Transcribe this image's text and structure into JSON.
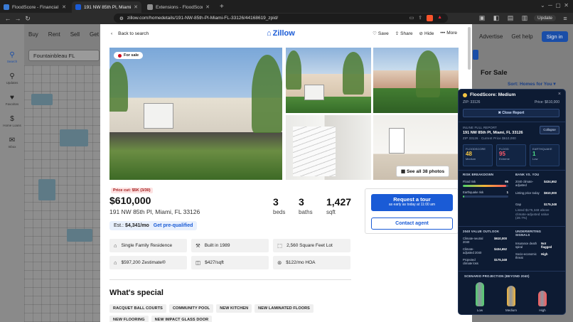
{
  "browser": {
    "tabs": [
      {
        "title": "FloodScore - Financial Transparency",
        "active": false,
        "color": "#3a7bd5"
      },
      {
        "title": "191 NW 85th Pl, Miami, FL 3...",
        "active": true,
        "color": "#1a5bd6"
      },
      {
        "title": "Extensions - FloodScore",
        "active": false,
        "color": "#8e8e8e"
      }
    ],
    "url": "zillow.com/homedetails/191-NW-85th-Pl-Miami-FL-33126/44168619_zpid/",
    "update_label": "Update"
  },
  "background": {
    "nav": [
      "Buy",
      "Rent",
      "Sell",
      "Get a m..."
    ],
    "right_nav": [
      "Advertise",
      "Get help"
    ],
    "sign_in": "Sign in",
    "search_value": "Fountainbleau FL",
    "rail": [
      {
        "label": "Search",
        "icon": "search-icon"
      },
      {
        "label": "Updates",
        "icon": "updates-icon"
      },
      {
        "label": "Favorites",
        "icon": "heart-icon"
      },
      {
        "label": "Home Loans",
        "icon": "dollar-icon"
      },
      {
        "label": "Inbox",
        "icon": "inbox-icon"
      }
    ],
    "for_sale_heading": "For Sale",
    "sort_label": "Sort: Homes for You ▾"
  },
  "listing": {
    "back_label": "Back to search",
    "logo_text": "Zillow",
    "actions": [
      "Save",
      "Share",
      "Hide",
      "More"
    ],
    "badge": "For sale",
    "see_all": "See all 38 photos",
    "price_cut": "Price cut: $5K (3/30)",
    "price": "$610,000",
    "address": "191 NW 85th Pl, Miami, FL 33126",
    "beds": {
      "value": "3",
      "label": "beds"
    },
    "baths": {
      "value": "3",
      "label": "baths"
    },
    "sqft": {
      "value": "1,427",
      "label": "sqft"
    },
    "est_label": "Est.:",
    "est_value": "$4,341/mo",
    "prequal": "Get pre-qualified",
    "request_tour": "Request a tour",
    "request_sub": "as early as today at 11:00 am",
    "contact_agent": "Contact agent",
    "facts": [
      {
        "icon": "house-icon",
        "text": "Single Family Residence"
      },
      {
        "icon": "hammer-icon",
        "text": "Built in 1989"
      },
      {
        "icon": "lot-icon",
        "text": "2,560 Square Feet Lot"
      },
      {
        "icon": "zestimate-icon",
        "text": "$597,200 Zestimate®"
      },
      {
        "icon": "ruler-icon",
        "text": "$427/sqft"
      },
      {
        "icon": "hoa-icon",
        "text": "$122/mo HOA"
      }
    ],
    "whats_special": "What's special",
    "tags": [
      "RACQUET BALL COURTS",
      "COMMUNITY POOL",
      "NEW KITCHEN",
      "NEW LAMINATED FLOORS",
      "NEW FLOORING",
      "NEW IMPACT GLASS DOOR"
    ]
  },
  "floodscore": {
    "title": "FloodScore: Medium",
    "zip": "ZIP: 33126",
    "price": "Price: $610,000",
    "close_report": "✖ Close Report",
    "inline_label": "INLINE FULL REPORT",
    "address": "191 NW 85th Pl, Miami, FL 33126",
    "subline": "ZIP 33126 · Current Price $610,000",
    "collapse": "Collapse",
    "cards": [
      {
        "head": "FLOODSCORE",
        "num": "48",
        "desc": "Medium",
        "color": "#f5c542"
      },
      {
        "head": "FLOOD",
        "num": "95",
        "desc": "Extreme",
        "color": "#ff5a6a"
      },
      {
        "head": "EARTHQUAKE",
        "num": "1",
        "desc": "Low",
        "color": "#4fe08a"
      }
    ],
    "risk_breakdown": "RISK BREAKDOWN",
    "flood_risk_label": "Flood risk",
    "flood_risk_value": "95",
    "flood_risk_fraction": 0.95,
    "eq_risk_label": "Earthquake risk",
    "eq_risk_value": "1",
    "eq_risk_fraction": 0.01,
    "bank_title": "BANK VS. YOU",
    "bank_rows": [
      {
        "label": "2040 climate-adjusted",
        "value": "$434,652"
      },
      {
        "label": "Listing price today",
        "value": "$610,000"
      },
      {
        "label": "Gap",
        "value": "$175,348"
      }
    ],
    "bank_note": "Listed $175,348 above climate-adjusted value (28.7%)",
    "outlook_title": "2040 VALUE OUTLOOK",
    "outlook_rows": [
      {
        "label": "Climate-neutral 2040",
        "value": "$610,000"
      },
      {
        "label": "Climate-adjusted 2040",
        "value": "$434,652"
      },
      {
        "label": "Projected climate loss",
        "value": "$175,348"
      }
    ],
    "underwriting_title": "UNDERWRITING SIGNALS",
    "underwriting_rows": [
      {
        "label": "Insurance death spiral",
        "value": "Not flagged"
      },
      {
        "label": "Socio-economic threat",
        "value": "High"
      }
    ],
    "scenario_title": "SCENARIO PROJECTION (BEYOND 2040)",
    "scenarios": [
      {
        "label": "Low",
        "level": 0.95,
        "color": "#4fd36b"
      },
      {
        "label": "Medium",
        "level": 0.8,
        "color": "#f2b53a"
      },
      {
        "label": "High",
        "level": 0.62,
        "color": "#ff5a5a"
      }
    ]
  }
}
